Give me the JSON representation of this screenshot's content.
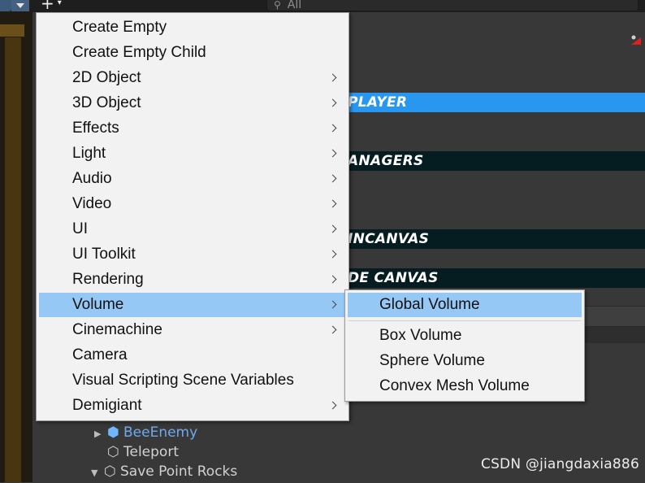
{
  "toolbar": {
    "plus_label": "+",
    "plus_caret": "▾",
    "search_placeholder": "All"
  },
  "hierarchy": {
    "rows": {
      "player": "PLAYER",
      "managers": "ANAGERS",
      "main_canvas": "INCANVAS",
      "de_canvas": "DE CANVAS"
    },
    "tree": [
      {
        "label": "BeeEnemy",
        "expander": "▶"
      },
      {
        "label": "Teleport",
        "expander": ""
      },
      {
        "label": "Save Point Rocks",
        "expander": "▼"
      }
    ],
    "accent_color": "#2997f0",
    "header_color": "#051d20"
  },
  "context_menu": {
    "items": [
      {
        "label": "Create Empty",
        "submenu": false
      },
      {
        "label": "Create Empty Child",
        "submenu": false
      },
      {
        "label": "2D Object",
        "submenu": true
      },
      {
        "label": "3D Object",
        "submenu": true
      },
      {
        "label": "Effects",
        "submenu": true
      },
      {
        "label": "Light",
        "submenu": true
      },
      {
        "label": "Audio",
        "submenu": true
      },
      {
        "label": "Video",
        "submenu": true
      },
      {
        "label": "UI",
        "submenu": true
      },
      {
        "label": "UI Toolkit",
        "submenu": true
      },
      {
        "label": "Rendering",
        "submenu": true
      },
      {
        "label": "Volume",
        "submenu": true,
        "highlighted": true
      },
      {
        "label": "Cinemachine",
        "submenu": true
      },
      {
        "label": "Camera",
        "submenu": false
      },
      {
        "label": "Visual Scripting Scene Variables",
        "submenu": false
      },
      {
        "label": "Demigiant",
        "submenu": true
      }
    ],
    "highlight_color": "#96c8f5"
  },
  "volume_submenu": {
    "items": [
      {
        "label": "Global Volume",
        "highlighted": true
      },
      {
        "label": "Box Volume"
      },
      {
        "label": "Sphere Volume"
      },
      {
        "label": "Convex Mesh Volume"
      }
    ]
  },
  "watermark": "CSDN @jiangdaxia886"
}
